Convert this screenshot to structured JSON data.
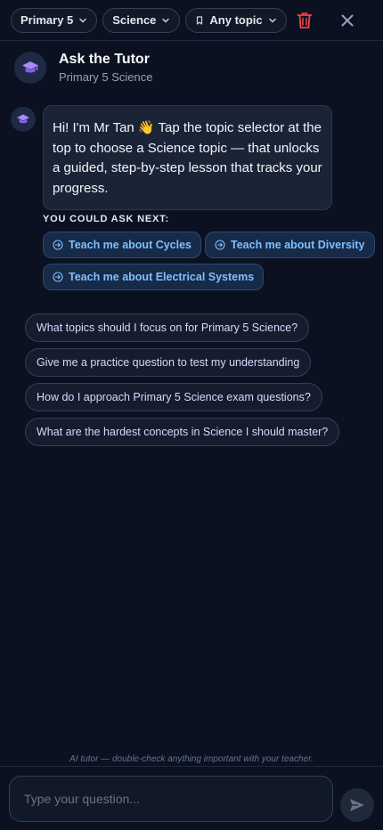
{
  "topbar": {
    "level_select": "Primary 5",
    "subject_select": "Science",
    "topic_select": "Any topic",
    "icons": [
      "chevron-down-icon",
      "bookmark-icon",
      "trash-icon",
      "close-icon"
    ],
    "trash_color": "#ef4444"
  },
  "header": {
    "title": "Ask the Tutor",
    "subtitle": "Primary 5 Science",
    "icon": "graduation-cap-icon",
    "accent": "#8b5cf6"
  },
  "message": {
    "text": "Hi! I'm Mr Tan 👋 Tap the topic selector at the top to choose a Science topic — that unlocks a guided, step-by-step lesson that tracks your progress."
  },
  "ask_next": {
    "label": "YOU COULD ASK NEXT:",
    "chips": [
      "Teach me about Cycles",
      "Teach me about Diversity",
      "Teach me about Electrical Systems"
    ],
    "chip_icon": "arrow-circle-right-icon"
  },
  "suggestions": [
    "What topics should I focus on for Primary 5 Science?",
    "Give me a practice question to test my understanding",
    "How do I approach Primary 5 Science exam questions?",
    "What are the hardest concepts in Science I should master?"
  ],
  "footer": {
    "disclaimer": "AI tutor — double-check anything important with your teacher.",
    "input_placeholder": "Type your question...",
    "send_icon": "send-icon"
  }
}
